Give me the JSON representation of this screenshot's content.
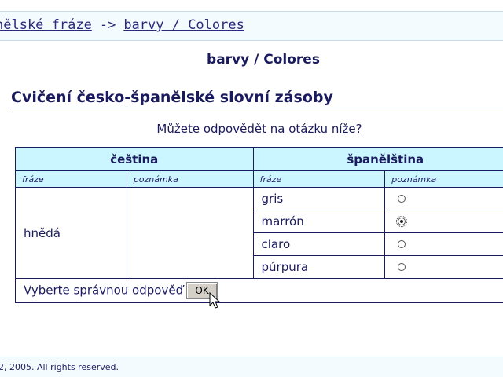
{
  "breadcrumb": {
    "parent_link": "nělské fráze",
    "separator": "->",
    "current_link": "barvy / Colores"
  },
  "subtitle": "barvy / Colores",
  "heading": "Cvičení česko-španělské slovní zásoby",
  "question": "Můžete odpovědět na otázku níže?",
  "table": {
    "lang_left": "čeština",
    "lang_right": "španělština",
    "sub_headers": [
      "fráze",
      "poznámka",
      "fráze",
      "poznámka"
    ],
    "czech_word": "hnědá",
    "czech_note": "",
    "options": [
      {
        "label": "gris",
        "checked": false
      },
      {
        "label": "marrón",
        "checked": true
      },
      {
        "label": "claro",
        "checked": false
      },
      {
        "label": "púrpura",
        "checked": false
      }
    ],
    "submit_prompt": "Vyberte správnou odpověď",
    "ok_label": "OK"
  },
  "footer": "2, 2005. All rights reserved.",
  "colors": {
    "header_bg": "#ccf6ff",
    "text": "#1a1a5e",
    "bar_bg": "#f3fbff"
  }
}
